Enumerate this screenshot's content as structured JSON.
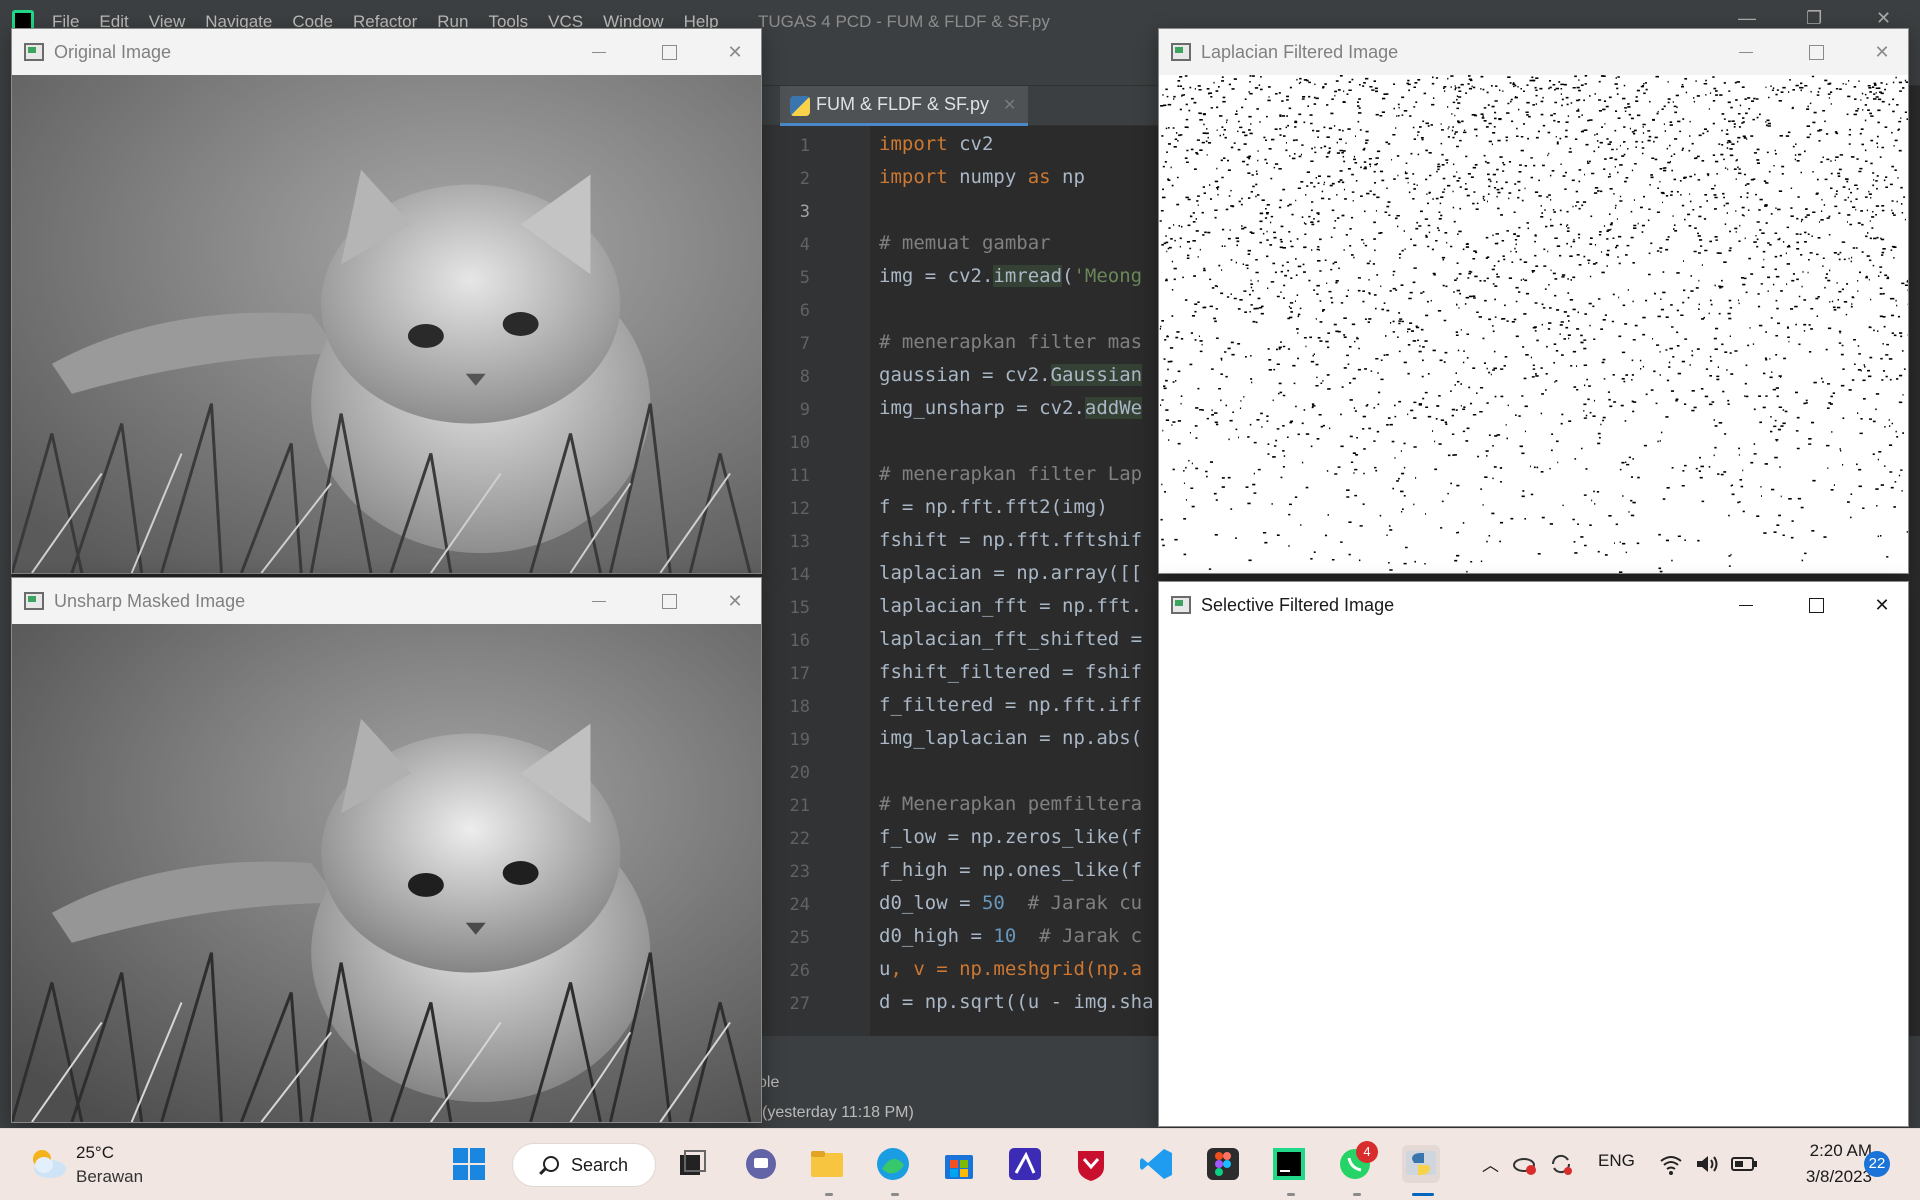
{
  "ide": {
    "menu": [
      "File",
      "Edit",
      "View",
      "Navigate",
      "Code",
      "Refactor",
      "Run",
      "Tools",
      "VCS",
      "Window",
      "Help"
    ],
    "title": "TUGAS 4 PCD - FUM & FLDF & SF.py",
    "tab_label": "FUM & FLDF & SF.py",
    "line_numbers": [
      "1",
      "2",
      "3",
      "4",
      "5",
      "6",
      "7",
      "8",
      "9",
      "10",
      "11",
      "12",
      "13",
      "14",
      "15",
      "16",
      "17",
      "18",
      "19",
      "20",
      "21",
      "22",
      "23",
      "24",
      "25",
      "26",
      "27"
    ],
    "code": {
      "l1_kw": "import",
      "l1_rest": " cv2",
      "l2_kw": "import",
      "l2_mid": " numpy ",
      "l2_as": "as",
      "l2_end": " np",
      "l4": "# memuat gambar",
      "l5_a": "img = cv2.",
      "l5_fn": "imread",
      "l5_b": "(",
      "l5_str": "'Meong",
      "l7": "# menerapkan filter mas",
      "l8_a": "gaussian = cv2.",
      "l8_fn": "Gaussian",
      "l9_a": "img_unsharp = cv2.",
      "l9_fn": "addWe",
      "l11": "# menerapkan filter Lap",
      "l12": "f = np.fft.fft2(img)",
      "l13": "fshift = np.fft.fftshif",
      "l14": "laplacian = np.array([[",
      "l15": "laplacian_fft = np.fft.",
      "l16": "laplacian_fft_shifted =",
      "l17": "fshift_filtered = fshif",
      "l18": "f_filtered = np.fft.iff",
      "l19": "img_laplacian = np.abs(",
      "l21": "# Menerapkan pemfiltera",
      "l22": "f_low = np.zeros_like(f",
      "l23": "f_high = np.ones_like(f",
      "l24_a": "d0_low = ",
      "l24_num": "50",
      "l24_cm": "  # Jarak cu",
      "l25_a": "d0_high = ",
      "l25_num": "10",
      "l25_cm": "  # Jarak c",
      "l26_a": "u",
      "l26_b": ", v = np.meshgrid(np.a",
      "l27": "d = np.sqrt((u - img.sha"
    },
    "bottom_tool": "ole",
    "bottom_status": "(yesterday 11:18 PM)"
  },
  "windows": {
    "original": {
      "title": "Original Image"
    },
    "unsharp": {
      "title": "Unsharp Masked Image"
    },
    "laplacian": {
      "title": "Laplacian Filtered Image"
    },
    "selective": {
      "title": "Selective Filtered Image"
    }
  },
  "taskbar": {
    "temperature": "25°C",
    "weather": "Berawan",
    "search_label": "Search",
    "whatsapp_badge": "4",
    "language": "ENG",
    "time": "2:20 AM",
    "date": "3/8/2023",
    "notifications": "22",
    "colors": {
      "accent": "#0067c0",
      "badge": "#d92d2d"
    }
  }
}
